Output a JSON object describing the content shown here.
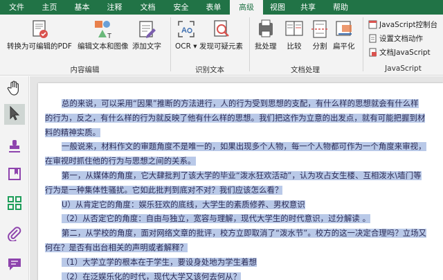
{
  "menu": {
    "tabs": [
      "文件",
      "主页",
      "基本",
      "注释",
      "文档",
      "安全",
      "表单",
      "高级",
      "视图",
      "共享",
      "帮助"
    ],
    "active": "高级"
  },
  "ribbon": {
    "content_edit": {
      "convert_label": "转换为可编辑的PDF",
      "edit_text_image_label": "编辑文本和图像",
      "add_text_label": "添加文字",
      "group_label": "内容编辑"
    },
    "recognize": {
      "ocr_label": "OCR",
      "find_editable_label": "发现可疑元素",
      "group_label": "识别文本"
    },
    "doc_process": {
      "batch_label": "批处理",
      "compare_label": "比较",
      "split_label": "分割",
      "flatten_label": "扁平化",
      "group_label": "文档处理"
    },
    "javascript": {
      "console_label": "JavaScript控制台",
      "doc_action_label": "设置文档动作",
      "doc_js_label": "文档JavaScript",
      "group_label": "JavaScript"
    }
  },
  "left_tools": [
    "hand-tool",
    "select-tool",
    "stamp-tool",
    "bookmark-tool",
    "thumbnails-tool",
    "attachment-tool",
    "comment-tool"
  ],
  "document": {
    "lines": [
      "总的来说，可以采用“因果”推断的方法进行，人的行为受到思想的支配，有什么样的思想就会有什么样",
      "的行为，反之，有什么样的行为就反映了他有什么样的思想。我们把这作为立意的出发点，就有可能把握到材",
      "料的精神实质。",
      "一般说来，材料作文的审题角度不是唯一的，如果出现多个人物，每一个人物都可作为一个角度来审视，",
      "在审视时抓住他的行为与思想之间的关系。",
      "第一，从媒体的角度，它大肆批判了该大学的毕业“泼水狂欢活动”，认为攻占女生楼、互相泼水\\墙门等",
      "行为是一种集体性骚扰。它如此批判到底对不对？我们应该怎么看？",
      "U）从肯定它的角度：娱乐狂欢的底线，大学生的素质修养、男权意识",
      "（2）从否定它的角度：自由与独立，宽容与理解，现代大学生的时代意识，过分解读 。",
      "第二，从学校的角度，面对网络文章的批评，校方立即取消了“泼水节”。校方的这一决定合理吗？立场又",
      "何在？是否有出台相关的声明或者解释？",
      "（1）大学立学的根本在于学生，要设身处地为学生着想",
      "（2）在泛娱乐化的时代，现代大学又该何去何从？"
    ]
  },
  "colors": {
    "brand": "#217346",
    "highlight": "#b9c9e8",
    "text": "#2b2b55"
  }
}
